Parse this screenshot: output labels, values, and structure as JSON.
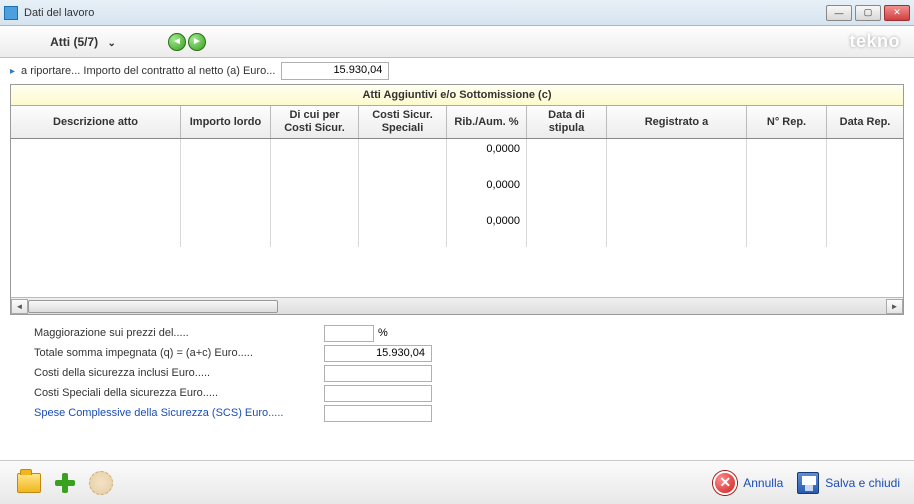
{
  "window": {
    "title": "Dati del lavoro"
  },
  "nav": {
    "title": "Atti (5/7)",
    "brand": "tekno"
  },
  "subheader": {
    "label": "a riportare... Importo del contratto al netto (a) Euro...",
    "value": "15.930,04"
  },
  "table": {
    "title": "Atti Aggiuntivi e/o Sottomissione (c)",
    "columns": [
      "Descrizione atto",
      "Importo lordo",
      "Di cui per Costi Sicur.",
      "Costi Sicur. Speciali",
      "Rib./Aum. %",
      "Data di stipula",
      "Registrato a",
      "N° Rep.",
      "Data Rep."
    ],
    "rows": [
      {
        "rib": "0,0000"
      },
      {
        "rib": "0,0000"
      },
      {
        "rib": "0,0000"
      }
    ]
  },
  "summary": {
    "r1": {
      "label": "Maggiorazione sui prezzi del.....",
      "value": "",
      "unit": "%"
    },
    "r2": {
      "label": "Totale somma impegnata (q) = (a+c) Euro.....",
      "value": "15.930,04"
    },
    "r3": {
      "label": "Costi della sicurezza inclusi  Euro.....",
      "value": ""
    },
    "r4": {
      "label": "Costi Speciali della sicurezza  Euro.....",
      "value": ""
    },
    "r5": {
      "label": "Spese Complessive della Sicurezza (SCS)  Euro.....",
      "value": ""
    }
  },
  "footer": {
    "cancel": "Annulla",
    "save": "Salva e chiudi"
  }
}
